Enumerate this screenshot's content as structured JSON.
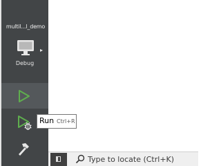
{
  "sidebar": {
    "project_name": "multil...l_demo",
    "kit": {
      "icon": "monitor-icon",
      "label": "Debug",
      "chevron": "▸"
    },
    "run_button": {
      "icon": "play-icon",
      "color": "#5fae4e"
    },
    "debug_button": {
      "icon": "debug-run-icon",
      "color": "#5fae4e"
    },
    "build_button": {
      "icon": "hammer-icon"
    }
  },
  "tooltip": {
    "name": "Run",
    "shortcut": "Ctrl+R"
  },
  "locator": {
    "toggle_icon": "sidebar-toggle-icon",
    "search_icon": "search-icon",
    "placeholder": "Type to locate (Ctrl+K)"
  },
  "colors": {
    "sidebar_bg": "#424547",
    "active_button_bg": "#54585b",
    "run_green": "#5fae4e"
  }
}
